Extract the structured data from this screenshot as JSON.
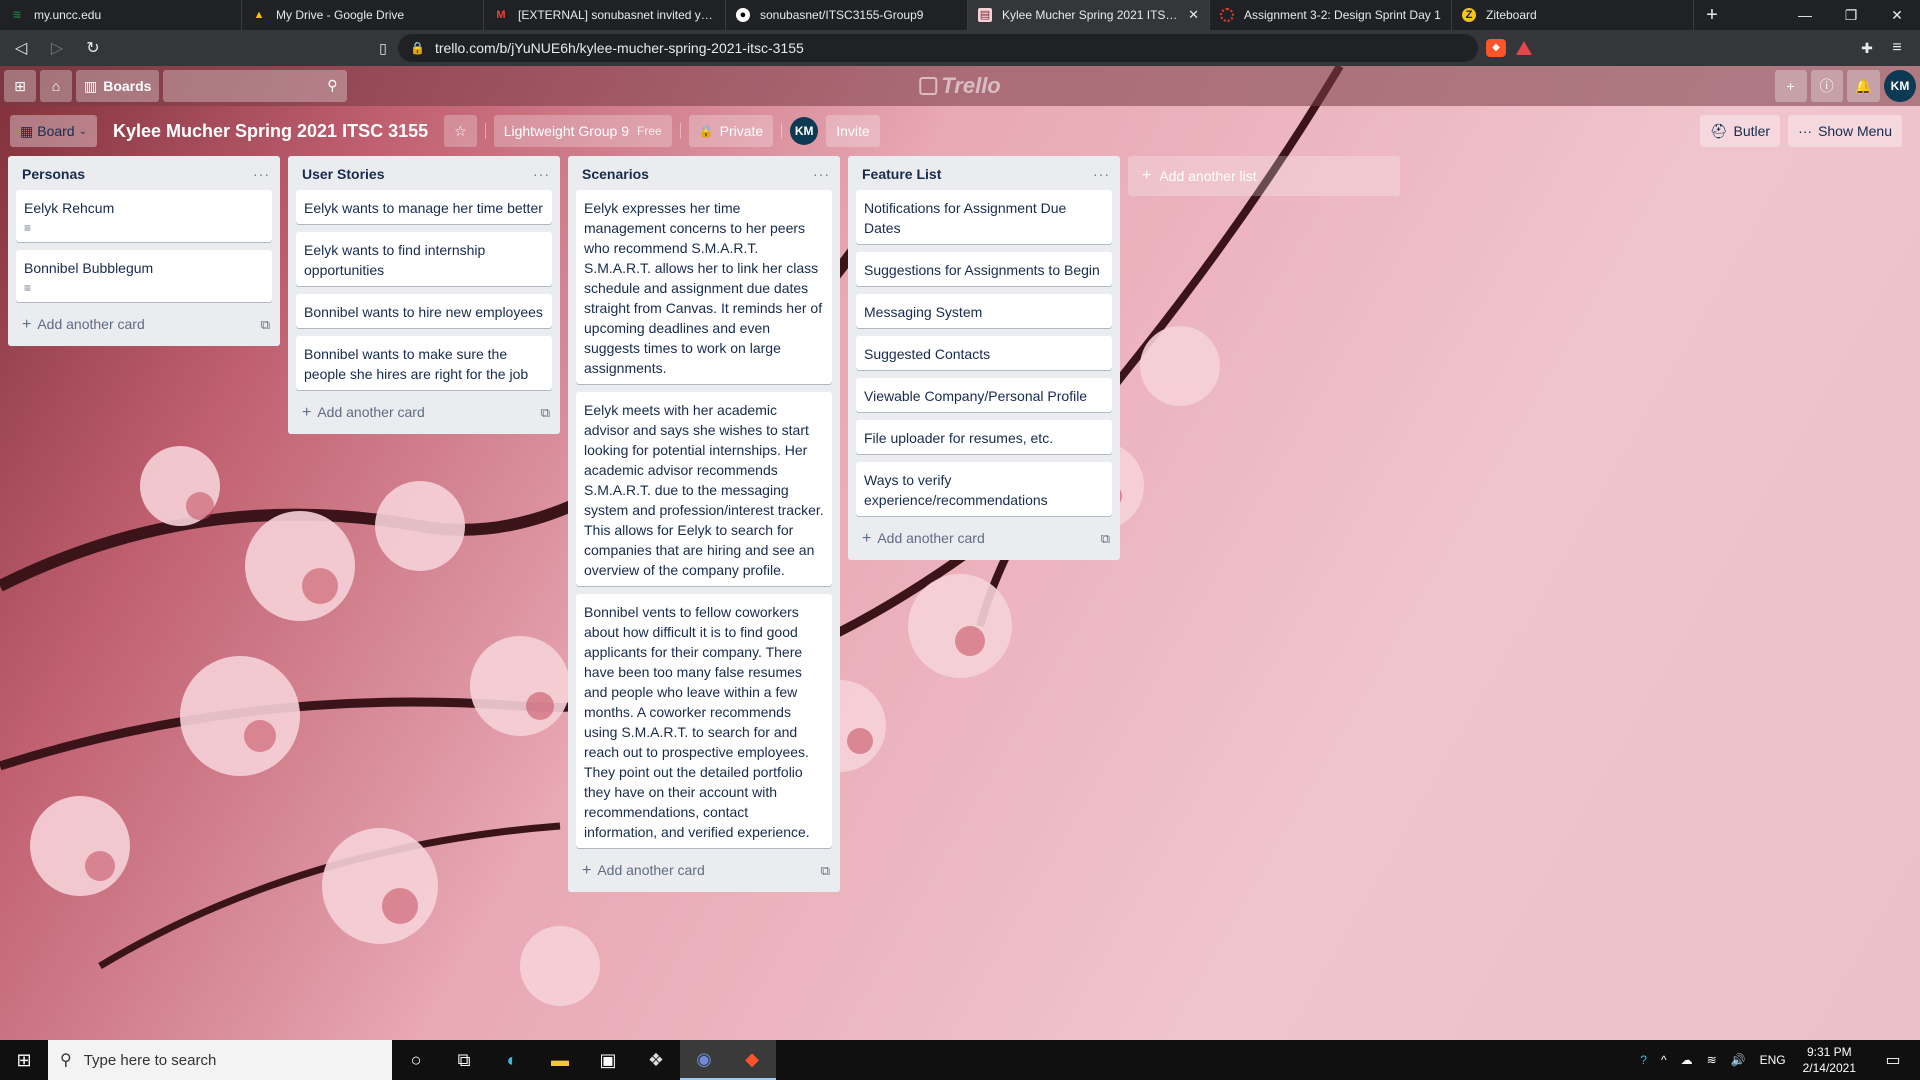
{
  "browser": {
    "tabs": [
      {
        "title": "my.uncc.edu",
        "icon": "uncc-icon",
        "active": false
      },
      {
        "title": "My Drive - Google Drive",
        "icon": "google-drive-icon",
        "active": false
      },
      {
        "title": "[EXTERNAL] sonubasnet invited you to",
        "icon": "gmail-icon",
        "active": false
      },
      {
        "title": "sonubasnet/ITSC3155-Group9",
        "icon": "github-icon",
        "active": false
      },
      {
        "title": "Kylee Mucher Spring 2021 ITSC 3155",
        "icon": "trello-icon",
        "active": true
      },
      {
        "title": "Assignment 3-2: Design Sprint Day 1",
        "icon": "canvas-icon",
        "active": false
      },
      {
        "title": "Ziteboard",
        "icon": "ziteboard-icon",
        "active": false
      }
    ],
    "new_tab": "+",
    "url": "trello.com/b/jYuNUE6h/kylee-mucher-spring-2021-itsc-3155"
  },
  "trello_header": {
    "boards_label": "Boards",
    "logo_text": "Trello",
    "user_initials": "KM"
  },
  "board": {
    "view_label": "Board",
    "title": "Kylee Mucher Spring 2021 ITSC 3155",
    "team_label": "Lightweight Group 9",
    "plan_label": "Free",
    "visibility_label": "Private",
    "member_initials": "KM",
    "invite_label": "Invite",
    "butler_label": "Butler",
    "show_menu_label": "Show Menu",
    "add_list_label": "Add another list",
    "add_card_label": "Add another card",
    "lists": [
      {
        "name": "Personas",
        "cards": [
          {
            "text": "Eelyk Rehcum",
            "has_description": true
          },
          {
            "text": "Bonnibel Bubblegum",
            "has_description": true
          }
        ]
      },
      {
        "name": "User Stories",
        "cards": [
          {
            "text": "Eelyk wants to manage her time better",
            "has_description": false
          },
          {
            "text": "Eelyk wants to find internship opportunities",
            "has_description": false
          },
          {
            "text": "Bonnibel wants to hire new employees",
            "has_description": false
          },
          {
            "text": "Bonnibel wants to make sure the people she hires are right for the job",
            "has_description": false
          }
        ]
      },
      {
        "name": "Scenarios",
        "cards": [
          {
            "text": "Eelyk expresses her time management concerns to her peers who recommend S.M.A.R.T. S.M.A.R.T. allows her to link her class schedule and assignment due dates straight from Canvas. It reminds her of upcoming deadlines and even suggests times to work on large assignments.",
            "has_description": false
          },
          {
            "text": "Eelyk meets with her academic advisor and says she wishes to start looking for potential internships. Her academic advisor recommends S.M.A.R.T. due to the messaging system and profession/interest tracker. This allows for Eelyk to search for companies that are hiring and see an overview of the company profile.",
            "has_description": false
          },
          {
            "text": "Bonnibel vents to fellow coworkers about how difficult it is to find good applicants for their company. There have been too many false resumes and people who leave within a few months. A coworker recommends using S.M.A.R.T. to search for and reach out to prospective employees. They point out the detailed portfolio they have on their account with recommendations, contact information, and verified experience.",
            "has_description": false
          }
        ]
      },
      {
        "name": "Feature List",
        "cards": [
          {
            "text": "Notifications for Assignment Due Dates",
            "has_description": false
          },
          {
            "text": "Suggestions for Assignments to Begin",
            "has_description": false
          },
          {
            "text": "Messaging System",
            "has_description": false
          },
          {
            "text": "Suggested Contacts",
            "has_description": false
          },
          {
            "text": "Viewable Company/Personal Profile",
            "has_description": false
          },
          {
            "text": "File uploader for resumes, etc.",
            "has_description": false
          },
          {
            "text": "Ways to verify experience/recommendations",
            "has_description": false
          }
        ]
      }
    ]
  },
  "taskbar": {
    "search_placeholder": "Type here to search",
    "language": "ENG",
    "time": "9:31 PM",
    "date": "2/14/2021"
  }
}
